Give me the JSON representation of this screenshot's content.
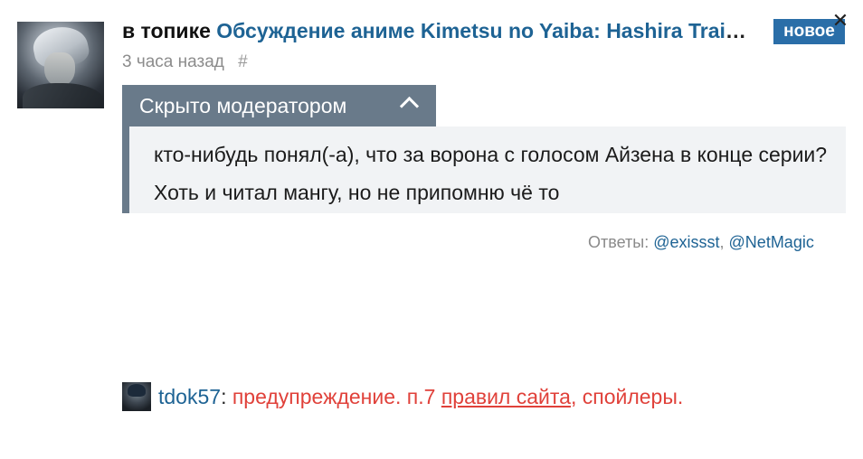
{
  "comment": {
    "prefix": "в топике",
    "topic_title": "Обсуждение аниме Kimetsu no Yaiba: Hashira Training Arc",
    "time_ago": "3 часа назад",
    "permalink": "#",
    "new_badge": "новое",
    "close_symbol": "✕",
    "hidden_label": "Скрыто модератором",
    "hidden_text": "кто-нибудь понял(-а), что за ворона с голосом Айзена в конце серии? Хоть и читал мангу, но не припомню чё то",
    "replies_label": "Ответы:",
    "replies": [
      "@exissst",
      "@NetMagic"
    ],
    "replies_separator": ", "
  },
  "moderator": {
    "username": "tdok57",
    "colon": ":",
    "warning_prefix": "предупреждение. п.7",
    "rules_link": "правил сайта",
    "warning_suffix": ", спойлеры."
  },
  "colors": {
    "link": "#1e6394",
    "badge": "#2a6ea8",
    "moderated_bar": "#697a8a",
    "moderated_bg": "#f1f3f5",
    "warning": "#e0413a"
  }
}
